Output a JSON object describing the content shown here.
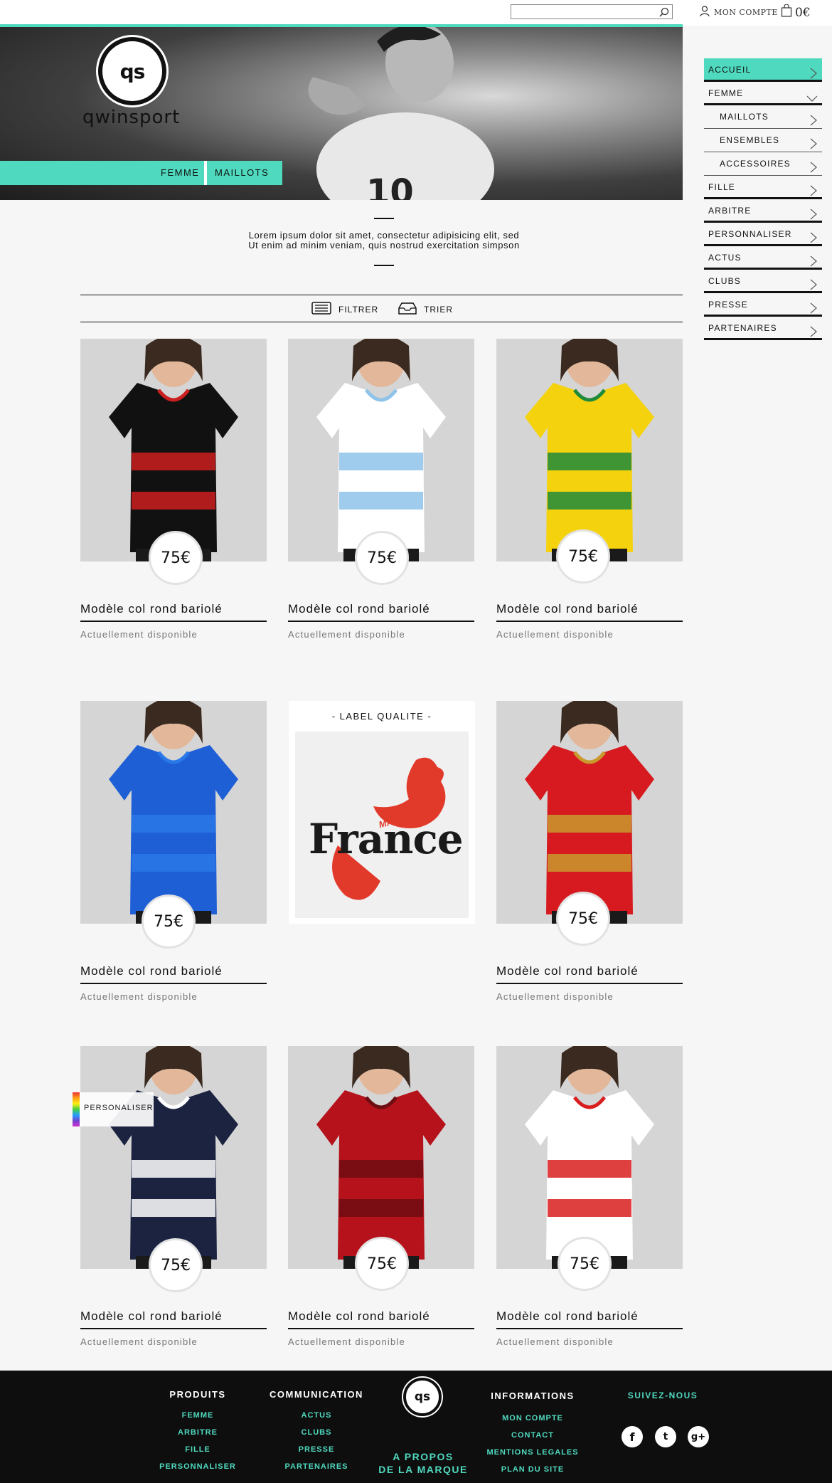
{
  "header": {
    "search_placeholder": "",
    "account_label": "MON COMPTE",
    "cart_total": "0€"
  },
  "hero": {
    "logo_text": "qs",
    "brand_name": "qwinsport",
    "tabs": [
      "FEMME",
      "MAILLOTS"
    ]
  },
  "sidebar": {
    "items": [
      {
        "label": "ACCUEIL",
        "active": true,
        "sub": false,
        "icon": "chevron-right-icon"
      },
      {
        "label": "FEMME",
        "active": false,
        "sub": false,
        "icon": "chevron-down-icon"
      },
      {
        "label": "MAILLOTS",
        "active": false,
        "sub": true,
        "icon": "chevron-right-icon"
      },
      {
        "label": "ENSEMBLES",
        "active": false,
        "sub": true,
        "icon": "chevron-right-icon"
      },
      {
        "label": "ACCESSOIRES",
        "active": false,
        "sub": true,
        "icon": "chevron-right-icon"
      },
      {
        "label": "FILLE",
        "active": false,
        "sub": false,
        "icon": "chevron-right-icon"
      },
      {
        "label": "ARBITRE",
        "active": false,
        "sub": false,
        "icon": "chevron-right-icon"
      },
      {
        "label": "PERSONNALISER",
        "active": false,
        "sub": false,
        "icon": "chevron-right-icon"
      },
      {
        "label": "ACTUS",
        "active": false,
        "sub": false,
        "icon": "chevron-right-icon"
      },
      {
        "label": "CLUBS",
        "active": false,
        "sub": false,
        "icon": "chevron-right-icon"
      },
      {
        "label": "PRESSE",
        "active": false,
        "sub": false,
        "icon": "chevron-right-icon"
      },
      {
        "label": "PARTENAIRES",
        "active": false,
        "sub": false,
        "icon": "chevron-right-icon"
      }
    ]
  },
  "intro": {
    "line1": "Lorem ipsum dolor sit amet, consectetur adipisicing elit, sed",
    "line2": "Ut enim ad minim veniam, quis nostrud exercitation simpson"
  },
  "toolbar": {
    "filter_label": "FILTRER",
    "sort_label": "TRIER"
  },
  "products": [
    {
      "name": "Modèle col rond bariolé",
      "price": "75€",
      "availability": "Actuellement disponible",
      "shirt_colors": [
        "#111111",
        "#cc1f1f"
      ]
    },
    {
      "name": "Modèle col rond bariolé",
      "price": "75€",
      "availability": "Actuellement disponible",
      "shirt_colors": [
        "#ffffff",
        "#8ec3ea"
      ]
    },
    {
      "name": "Modèle col rond bariolé",
      "price": "75€",
      "availability": "Actuellement disponible",
      "shirt_colors": [
        "#f5d20e",
        "#1f8a3a"
      ]
    },
    {
      "name": "Modèle col rond bariolé",
      "price": "75€",
      "availability": "Actuellement disponible",
      "shirt_colors": [
        "#1f5fd6",
        "#2a78e8"
      ]
    },
    {
      "name": "Modèle col rond bariolé",
      "price": "75€",
      "availability": "Actuellement disponible",
      "shirt_colors": [
        "#d61a1f",
        "#c99a2e"
      ]
    },
    {
      "name": "Modèle col rond bariolé",
      "price": "75€",
      "availability": "Actuellement disponible",
      "shirt_colors": [
        "#1c2340",
        "#ffffff"
      ]
    },
    {
      "name": "Modèle col rond bariolé",
      "price": "75€",
      "availability": "Actuellement disponible",
      "shirt_colors": [
        "#b5121b",
        "#6e0d12"
      ]
    },
    {
      "name": "Modèle col rond bariolé",
      "price": "75€",
      "availability": "Actuellement disponible",
      "shirt_colors": [
        "#ffffff",
        "#d81e1e"
      ]
    }
  ],
  "label_card": {
    "title": "- LABEL QUALITE -",
    "made_in": "MADE IN",
    "country": "France"
  },
  "personaliser_badge": "PERSONALISER",
  "footer": {
    "logo_text": "qs",
    "columns": [
      {
        "heading": "PRODUITS",
        "links": [
          "FEMME",
          "ARBITRE",
          "FILLE",
          "PERSONNALISER"
        ]
      },
      {
        "heading": "COMMUNICATION",
        "links": [
          "ACTUS",
          "CLUBS",
          "PRESSE",
          "PARTENAIRES"
        ]
      },
      {
        "heading": "INFORMATIONS",
        "links": [
          "MON COMPTE",
          "CONTACT",
          "MENTIONS LEGALES",
          "PLAN DU SITE"
        ]
      }
    ],
    "about_line1": "A PROPOS",
    "about_line2": "DE LA MARQUE",
    "follow_label": "SUIVEZ-NOUS",
    "social": [
      "f",
      "t",
      "g+"
    ]
  },
  "colors": {
    "accent": "#4fd9be",
    "footer_bg": "#0e0e0e",
    "page_bg": "#f5f6f5"
  }
}
